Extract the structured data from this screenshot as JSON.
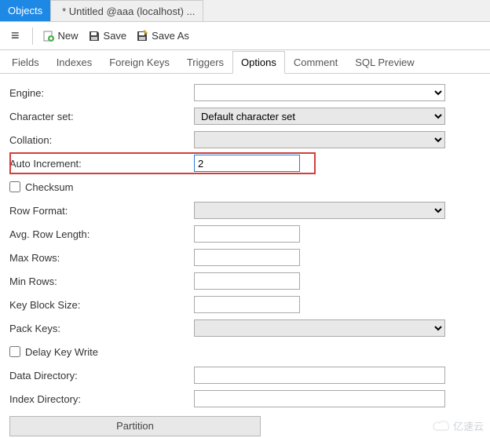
{
  "topTabs": {
    "objects": "Objects",
    "untitled": "* Untitled @aaa (localhost) ..."
  },
  "toolbar": {
    "new": "New",
    "save": "Save",
    "saveAs": "Save As"
  },
  "subtabs": {
    "fields": "Fields",
    "indexes": "Indexes",
    "foreignKeys": "Foreign Keys",
    "triggers": "Triggers",
    "options": "Options",
    "comment": "Comment",
    "sqlPreview": "SQL Preview"
  },
  "form": {
    "engine_label": "Engine:",
    "engine_value": "",
    "charset_label": "Character set:",
    "charset_value": "Default character set",
    "collation_label": "Collation:",
    "collation_value": "",
    "autoinc_label": "Auto Increment:",
    "autoinc_value": "2",
    "checksum_label": "Checksum",
    "rowformat_label": "Row Format:",
    "rowformat_value": "",
    "avgrowlen_label": "Avg. Row Length:",
    "avgrowlen_value": "",
    "maxrows_label": "Max Rows:",
    "maxrows_value": "",
    "minrows_label": "Min Rows:",
    "minrows_value": "",
    "keyblock_label": "Key Block Size:",
    "keyblock_value": "",
    "packkeys_label": "Pack Keys:",
    "packkeys_value": "",
    "delaykey_label": "Delay Key Write",
    "datadir_label": "Data Directory:",
    "datadir_value": "",
    "indexdir_label": "Index Directory:",
    "indexdir_value": "",
    "partition_label": "Partition"
  },
  "watermark": "亿速云"
}
